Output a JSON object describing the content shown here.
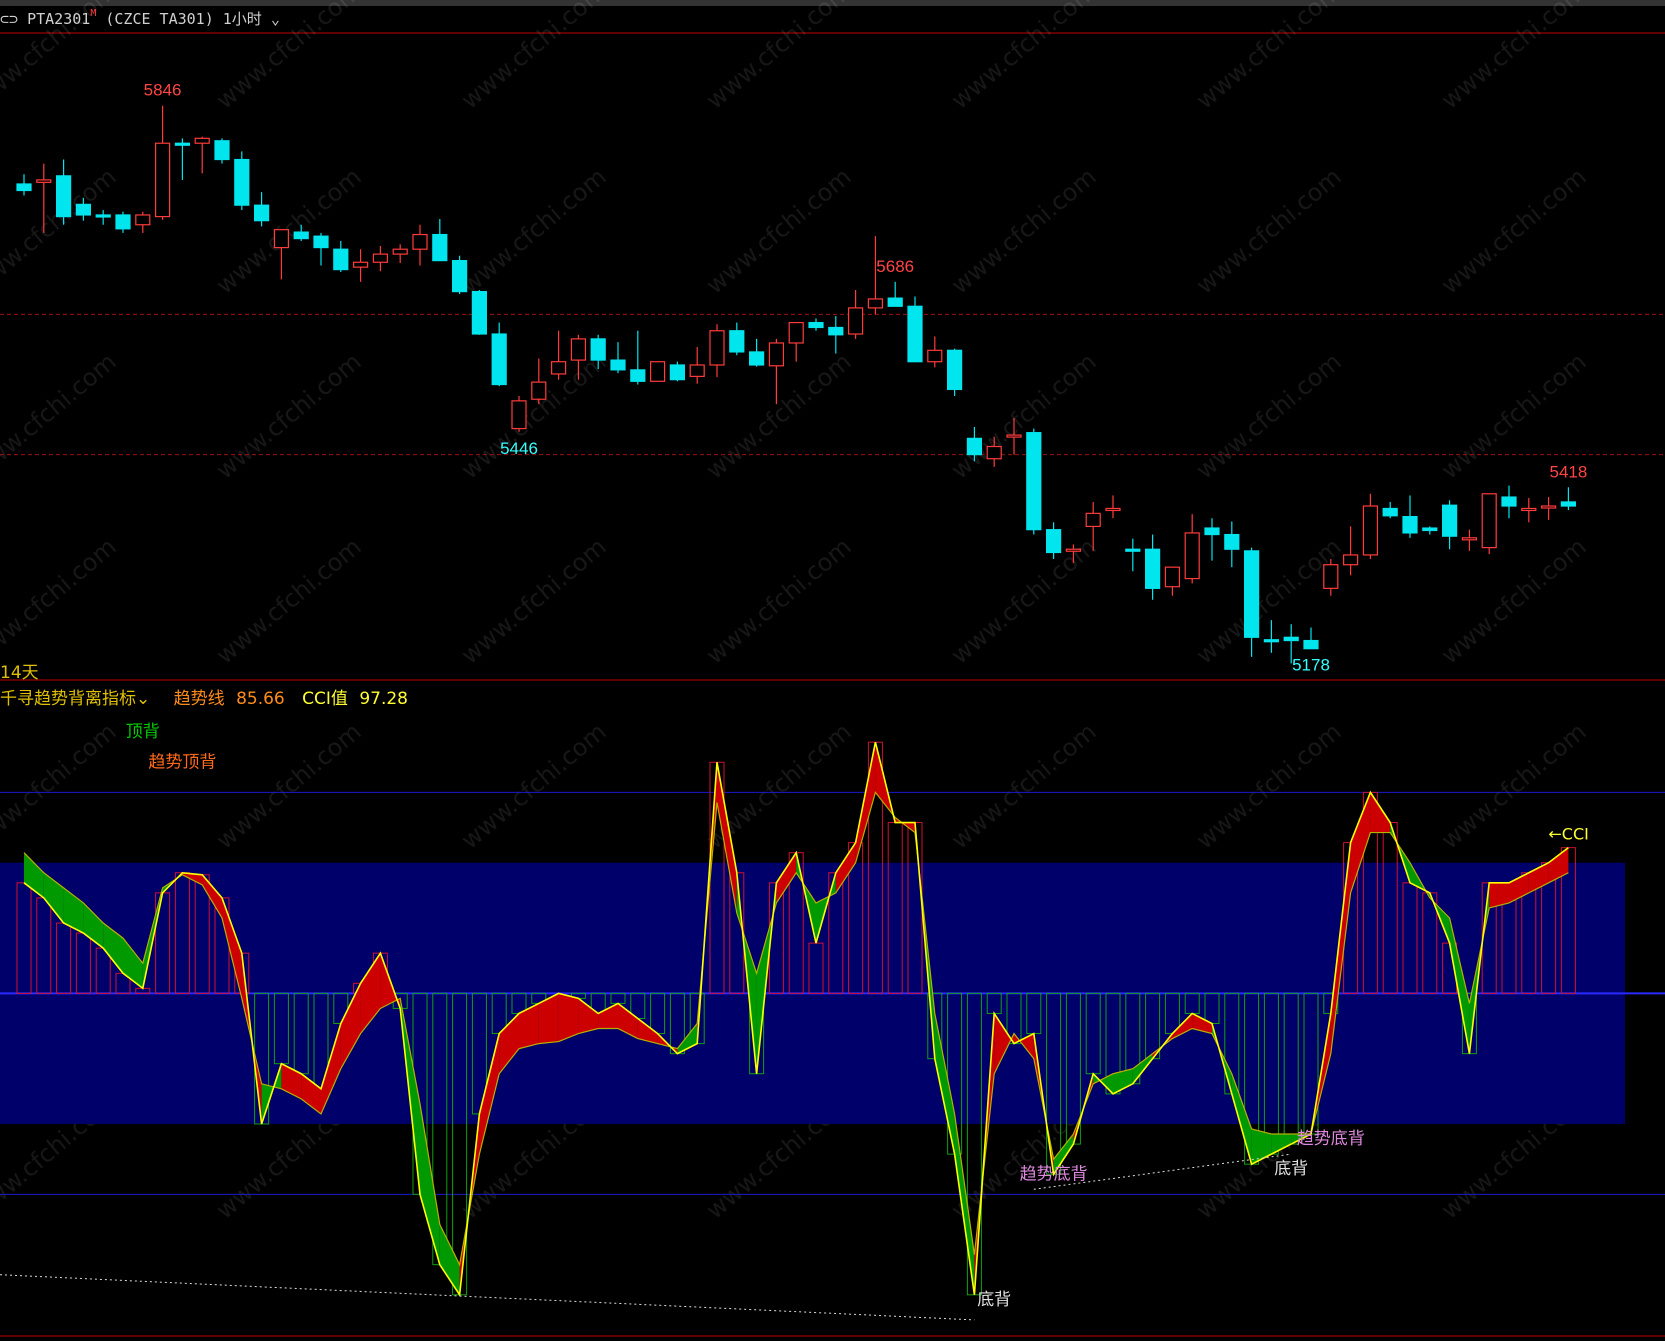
{
  "header": {
    "symbol": "PTA2301",
    "marker": "M",
    "exchange_code": "(CZCE  TA301)",
    "period": "1小时"
  },
  "price_panel": {
    "left_label": "14天",
    "dashed_levels": [
      5590,
      5418
    ],
    "price_labels": [
      {
        "text": "5846",
        "bar": 7,
        "kind": "high",
        "color": "#ff4444"
      },
      {
        "text": "5686",
        "bar": 44,
        "kind": "high",
        "color": "#ff4444"
      },
      {
        "text": "5446",
        "bar": 25,
        "kind": "low",
        "color": "#33ffff"
      },
      {
        "text": "5178",
        "bar": 65,
        "kind": "low",
        "color": "#33ffff"
      },
      {
        "text": "5418",
        "bar": 78,
        "kind": "high",
        "color": "#ff4444"
      }
    ]
  },
  "indicator_panel": {
    "name": "千寻趋势背离指标",
    "trend_label": "趋势线",
    "trend_value": "85.66",
    "cci_label": "CCI值",
    "cci_value": "97.28",
    "cci_arrow": "←CCI",
    "signals": [
      {
        "text": "顶背",
        "bar": 6,
        "color": "#00cc00"
      },
      {
        "text": "趋势顶背",
        "bar": 8,
        "color": "#ff6a1a"
      },
      {
        "text": "趋势底背",
        "bar": 52,
        "color": "#dd88dd"
      },
      {
        "text": "底背",
        "bar": 49,
        "color": "#e0e0e0"
      },
      {
        "text": "底背",
        "bar": 64,
        "color": "#e0e0e0"
      },
      {
        "text": "趋势底背",
        "bar": 66,
        "color": "#dd88dd"
      }
    ]
  },
  "watermark": "www.cfchi.com",
  "colors": {
    "bg": "#000000",
    "up": "#ff3b3b",
    "down": "#00e5ee",
    "band": "#00006a",
    "border": "#c00000",
    "trend_fill_up": "#cc0000",
    "trend_fill_down": "#009900",
    "cci_line": "#ffff00"
  },
  "chart_data": [
    {
      "type": "candlestick",
      "title": "PTA2301 1小时",
      "ylim": [
        5160,
        5880
      ],
      "ohlc": [
        [
          5750,
          5762,
          5736,
          5742
        ],
        [
          5752,
          5775,
          5690,
          5755
        ],
        [
          5760,
          5780,
          5700,
          5710
        ],
        [
          5725,
          5733,
          5705,
          5712
        ],
        [
          5712,
          5718,
          5700,
          5710
        ],
        [
          5712,
          5716,
          5690,
          5695
        ],
        [
          5700,
          5716,
          5690,
          5712
        ],
        [
          5710,
          5846,
          5706,
          5800
        ],
        [
          5800,
          5806,
          5755,
          5798
        ],
        [
          5800,
          5808,
          5763,
          5806
        ],
        [
          5803,
          5806,
          5775,
          5780
        ],
        [
          5780,
          5790,
          5718,
          5724
        ],
        [
          5724,
          5740,
          5698,
          5705
        ],
        [
          5672,
          5690,
          5633,
          5694
        ],
        [
          5691,
          5700,
          5680,
          5683
        ],
        [
          5686,
          5690,
          5650,
          5672
        ],
        [
          5670,
          5680,
          5642,
          5645
        ],
        [
          5648,
          5670,
          5630,
          5654
        ],
        [
          5654,
          5674,
          5643,
          5664
        ],
        [
          5664,
          5676,
          5653,
          5670
        ],
        [
          5670,
          5700,
          5650,
          5688
        ],
        [
          5688,
          5707,
          5656,
          5656
        ],
        [
          5656,
          5662,
          5615,
          5618
        ],
        [
          5618,
          5620,
          5565,
          5566
        ],
        [
          5566,
          5580,
          5502,
          5504
        ],
        [
          5450,
          5490,
          5446,
          5484
        ],
        [
          5486,
          5536,
          5480,
          5507
        ],
        [
          5517,
          5570,
          5510,
          5532
        ],
        [
          5534,
          5565,
          5510,
          5560
        ],
        [
          5560,
          5565,
          5523,
          5534
        ],
        [
          5534,
          5556,
          5518,
          5522
        ],
        [
          5522,
          5570,
          5504,
          5508
        ],
        [
          5508,
          5530,
          5510,
          5532
        ],
        [
          5528,
          5532,
          5508,
          5510
        ],
        [
          5514,
          5550,
          5505,
          5528
        ],
        [
          5528,
          5578,
          5513,
          5570
        ],
        [
          5570,
          5580,
          5540,
          5544
        ],
        [
          5544,
          5560,
          5526,
          5528
        ],
        [
          5527,
          5560,
          5480,
          5555
        ],
        [
          5555,
          5565,
          5532,
          5580
        ],
        [
          5580,
          5585,
          5570,
          5574
        ],
        [
          5574,
          5588,
          5542,
          5565
        ],
        [
          5566,
          5620,
          5560,
          5598
        ],
        [
          5598,
          5686,
          5590,
          5609
        ],
        [
          5610,
          5630,
          5604,
          5600
        ],
        [
          5600,
          5612,
          5532,
          5532
        ],
        [
          5532,
          5563,
          5525,
          5546
        ],
        [
          5546,
          5548,
          5490,
          5498
        ],
        [
          5438,
          5452,
          5410,
          5418
        ],
        [
          5413,
          5440,
          5403,
          5428
        ],
        [
          5440,
          5463,
          5418,
          5442
        ],
        [
          5445,
          5450,
          5320,
          5326
        ],
        [
          5326,
          5335,
          5290,
          5298
        ],
        [
          5300,
          5308,
          5285,
          5302
        ],
        [
          5330,
          5360,
          5300,
          5346
        ],
        [
          5350,
          5368,
          5340,
          5352
        ],
        [
          5302,
          5315,
          5275,
          5301
        ],
        [
          5302,
          5320,
          5240,
          5254
        ],
        [
          5256,
          5278,
          5245,
          5280
        ],
        [
          5266,
          5345,
          5260,
          5322
        ],
        [
          5328,
          5340,
          5288,
          5320
        ],
        [
          5320,
          5336,
          5280,
          5302
        ],
        [
          5300,
          5304,
          5170,
          5194
        ],
        [
          5191,
          5215,
          5175,
          5190
        ],
        [
          5194,
          5210,
          5162,
          5190
        ],
        [
          5190,
          5206,
          5180,
          5180
        ],
        [
          5254,
          5290,
          5245,
          5283
        ],
        [
          5283,
          5330,
          5270,
          5295
        ],
        [
          5295,
          5370,
          5290,
          5355
        ],
        [
          5352,
          5360,
          5340,
          5343
        ],
        [
          5342,
          5368,
          5316,
          5322
        ],
        [
          5328,
          5330,
          5320,
          5325
        ],
        [
          5356,
          5362,
          5302,
          5318
        ],
        [
          5314,
          5326,
          5300,
          5316
        ],
        [
          5304,
          5310,
          5296,
          5370
        ],
        [
          5366,
          5380,
          5340,
          5355
        ],
        [
          5352,
          5365,
          5335,
          5352
        ],
        [
          5354,
          5366,
          5338,
          5355
        ],
        [
          5360,
          5378,
          5350,
          5355
        ]
      ]
    },
    {
      "type": "area",
      "title": "千寻趋势背离指标",
      "ylim": [
        -340,
        280
      ],
      "series": [
        {
          "name": "CCI值",
          "values": [
            110,
            95,
            70,
            60,
            45,
            20,
            5,
            100,
            120,
            118,
            95,
            40,
            -130,
            -70,
            -80,
            -95,
            -30,
            10,
            40,
            -15,
            -200,
            -270,
            -300,
            -120,
            -40,
            -20,
            -10,
            0,
            -5,
            -20,
            -10,
            -25,
            -40,
            -60,
            -50,
            230,
            120,
            -80,
            110,
            140,
            50,
            120,
            150,
            250,
            170,
            170,
            -65,
            -160,
            -300,
            -20,
            -50,
            -40,
            -180,
            -150,
            -80,
            -100,
            -90,
            -65,
            -40,
            -20,
            -30,
            -100,
            -170,
            -160,
            -150,
            -140,
            -20,
            150,
            200,
            170,
            110,
            100,
            50,
            -60,
            110,
            110,
            120,
            130,
            145
          ]
        },
        {
          "name": "趋势线",
          "values": [
            140,
            120,
            105,
            90,
            70,
            55,
            30,
            105,
            118,
            108,
            75,
            -5,
            -90,
            -95,
            -105,
            -120,
            -75,
            -40,
            -15,
            -5,
            -110,
            -230,
            -270,
            -160,
            -80,
            -55,
            -50,
            -48,
            -40,
            -35,
            -35,
            -45,
            -50,
            -55,
            -30,
            190,
            80,
            20,
            90,
            120,
            90,
            100,
            130,
            200,
            175,
            160,
            -20,
            -120,
            -260,
            -80,
            -40,
            -65,
            -165,
            -140,
            -90,
            -80,
            -75,
            -60,
            -45,
            -35,
            -40,
            -80,
            -135,
            -140,
            -140,
            -140,
            -60,
            100,
            160,
            160,
            130,
            95,
            75,
            -10,
            85,
            90,
            100,
            110,
            120
          ]
        }
      ]
    }
  ]
}
